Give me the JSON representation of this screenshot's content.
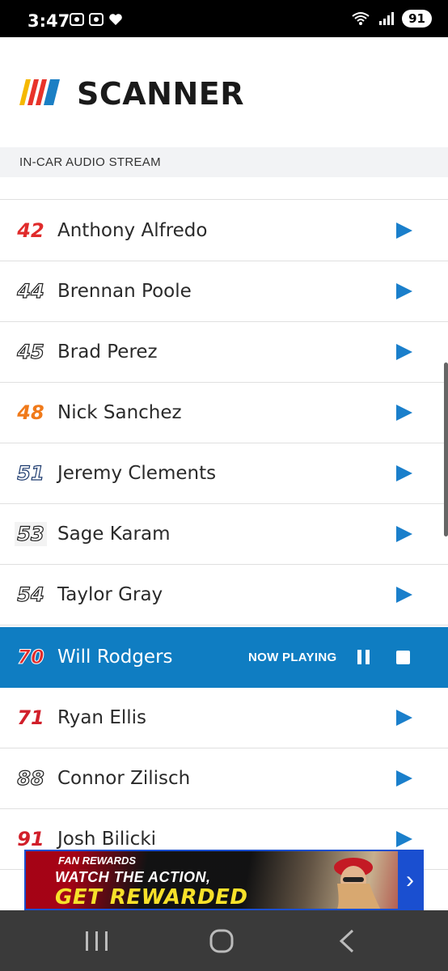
{
  "status_bar": {
    "time": "3:47",
    "battery": "91",
    "signal_label": "5"
  },
  "header": {
    "app_title": "SCANNER",
    "subtitle": "IN-CAR AUDIO STREAM"
  },
  "drivers": [
    {
      "number": "42",
      "name": "Anthony Alfredo",
      "number_color": "#e02b2b",
      "state": "idle"
    },
    {
      "number": "44",
      "name": "Brennan Poole",
      "number_color": "#222222",
      "state": "idle"
    },
    {
      "number": "45",
      "name": "Brad Perez",
      "number_color": "#222222",
      "state": "idle"
    },
    {
      "number": "48",
      "name": "Nick Sanchez",
      "number_color": "#f07a1a",
      "state": "idle"
    },
    {
      "number": "51",
      "name": "Jeremy Clements",
      "number_color": "#1c3a6e",
      "state": "idle"
    },
    {
      "number": "53",
      "name": "Sage Karam",
      "number_color": "#222222",
      "state": "idle"
    },
    {
      "number": "54",
      "name": "Taylor Gray",
      "number_color": "#222222",
      "state": "idle"
    },
    {
      "number": "70",
      "name": "Will Rodgers",
      "number_color": "#e02b2b",
      "state": "playing"
    },
    {
      "number": "71",
      "name": "Ryan Ellis",
      "number_color": "#d11f2a",
      "state": "idle"
    },
    {
      "number": "88",
      "name": "Connor Zilisch",
      "number_color": "#222222",
      "state": "idle"
    },
    {
      "number": "91",
      "name": "Josh Bilicki",
      "number_color": "#d11f2a",
      "state": "idle"
    }
  ],
  "now_playing_label": "NOW PLAYING",
  "ad": {
    "brand": "FAN REWARDS",
    "line1": "WATCH THE ACTION,",
    "line2": "GET REWARDED"
  },
  "colors": {
    "accent": "#0f7dc2",
    "play_icon": "#1a7fcb",
    "nav_bar": "#3a3a3a"
  }
}
